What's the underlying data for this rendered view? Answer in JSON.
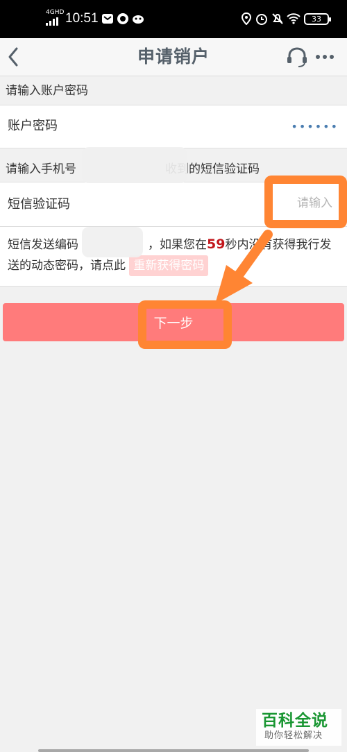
{
  "status_bar": {
    "network": "4GHD",
    "time": "10:51",
    "battery": "33"
  },
  "nav": {
    "title": "申请销户",
    "back_icon": "chevron-left-icon",
    "service_icon": "headset-icon",
    "more_icon": "more-dots-icon"
  },
  "password_section": {
    "label": "请输入账户密码",
    "field_label": "账户密码",
    "masked_value": "••••••"
  },
  "sms_section": {
    "label_prefix": "请输入手机号",
    "label_suffix": "收到的短信验证码",
    "field_label": "短信验证码",
    "placeholder": "请输入"
  },
  "sms_info": {
    "prefix": "短信发送编码",
    "middle": "，如果您在",
    "countdown": "59",
    "suffix": "秒内没有获得我行发送的动态密码，请点此",
    "resend_label": "重新获得密码"
  },
  "next_button": {
    "label": "下一步"
  },
  "colors": {
    "button": "#ff7b7b",
    "countdown": "#c2161b",
    "highlight": "#ff8533",
    "watermark": "#199632"
  },
  "watermark": {
    "title": "百科全说",
    "subtitle": "助你轻松解决"
  }
}
